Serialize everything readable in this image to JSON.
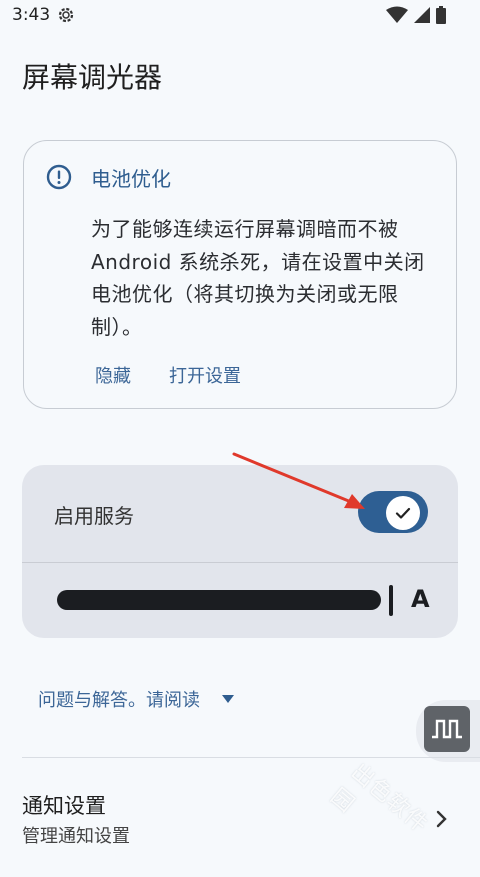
{
  "status_bar": {
    "time": "3:43"
  },
  "page": {
    "title": "屏幕调光器"
  },
  "battery_card": {
    "title": "电池优化",
    "body": "为了能够连续运行屏幕调暗而不被Android 系统杀死，请在设置中关闭电池优化（将其切换为关闭或无限制）。",
    "hide_label": "隐藏",
    "open_settings_label": "打开设置"
  },
  "service": {
    "label": "启用服务",
    "enabled": true,
    "brightness_level": 0.95,
    "slider_end_label": "A"
  },
  "faq": {
    "label": "问题与解答。请阅读"
  },
  "notification_settings": {
    "title": "通知设置",
    "subtitle": "管理通知设置"
  },
  "watermark": "出色软件园",
  "colors": {
    "accent": "#2e5f93",
    "link": "#3c6697",
    "arrow": "#e0392b"
  },
  "icons": [
    "gear-icon",
    "wifi-icon",
    "signal-icon",
    "battery-icon",
    "alert-circle-icon",
    "check-icon",
    "dropdown-arrow-icon",
    "pulse-wave-icon",
    "chevron-right-icon"
  ]
}
